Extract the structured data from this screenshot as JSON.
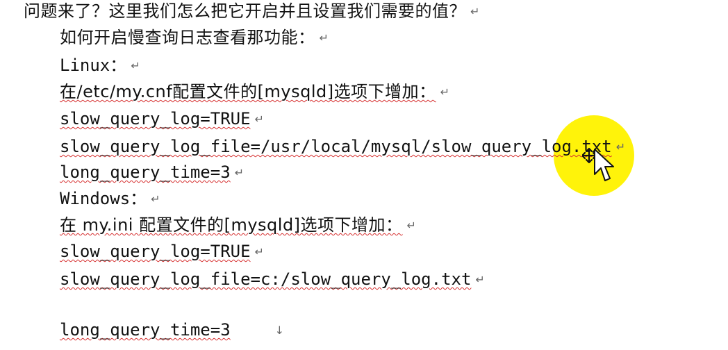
{
  "document": {
    "heading": "问题来了？这里我们怎么把它开启并且设置我们需要的值？",
    "lines": [
      "如何开启慢查询日志查看那功能：",
      "Linux：",
      "在/etc/my.cnf配置文件的[mysqld]选项下增加：",
      "slow_query_log=TRUE",
      "slow_query_log_file=/usr/local/mysql/slow_query_log.txt",
      "long_query_time=3",
      "Windows：",
      "在 my.ini 配置文件的[mysqld]选项下增加：",
      "slow_query_log=TRUE",
      "slow_query_log_file=c:/slow_query_log.txt",
      "long_query_time=3"
    ]
  },
  "marks": {
    "paragraph_mark": "↵",
    "down_mark": "↓"
  },
  "cursor": {
    "highlight_color": "#FFF200",
    "icon_name": "move-cursor-icon"
  }
}
